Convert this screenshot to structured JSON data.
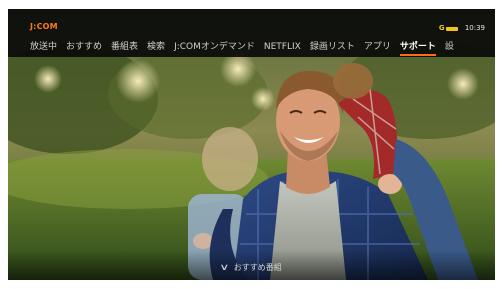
{
  "header": {
    "logo": "J:COM",
    "time": "10:39",
    "status_icon": "g-coin-indicator-icon"
  },
  "menu": {
    "items": [
      {
        "label": "放送中",
        "selected": false
      },
      {
        "label": "おすすめ",
        "selected": false
      },
      {
        "label": "番組表",
        "selected": false
      },
      {
        "label": "検索",
        "selected": false
      },
      {
        "label": "J:COMオンデマンド",
        "selected": false
      },
      {
        "label": "NETFLIX",
        "selected": false
      },
      {
        "label": "録画リスト",
        "selected": false
      },
      {
        "label": "アプリ",
        "selected": false
      },
      {
        "label": "サポート",
        "selected": true
      },
      {
        "label": "設",
        "selected": false
      }
    ]
  },
  "footer": {
    "recommend_label": "おすすめ番組",
    "icon": "chevron-down-icon"
  },
  "colors": {
    "accent": "#ff6a13",
    "logo": "#ff7a1a",
    "status_gold": "#f3c417"
  }
}
